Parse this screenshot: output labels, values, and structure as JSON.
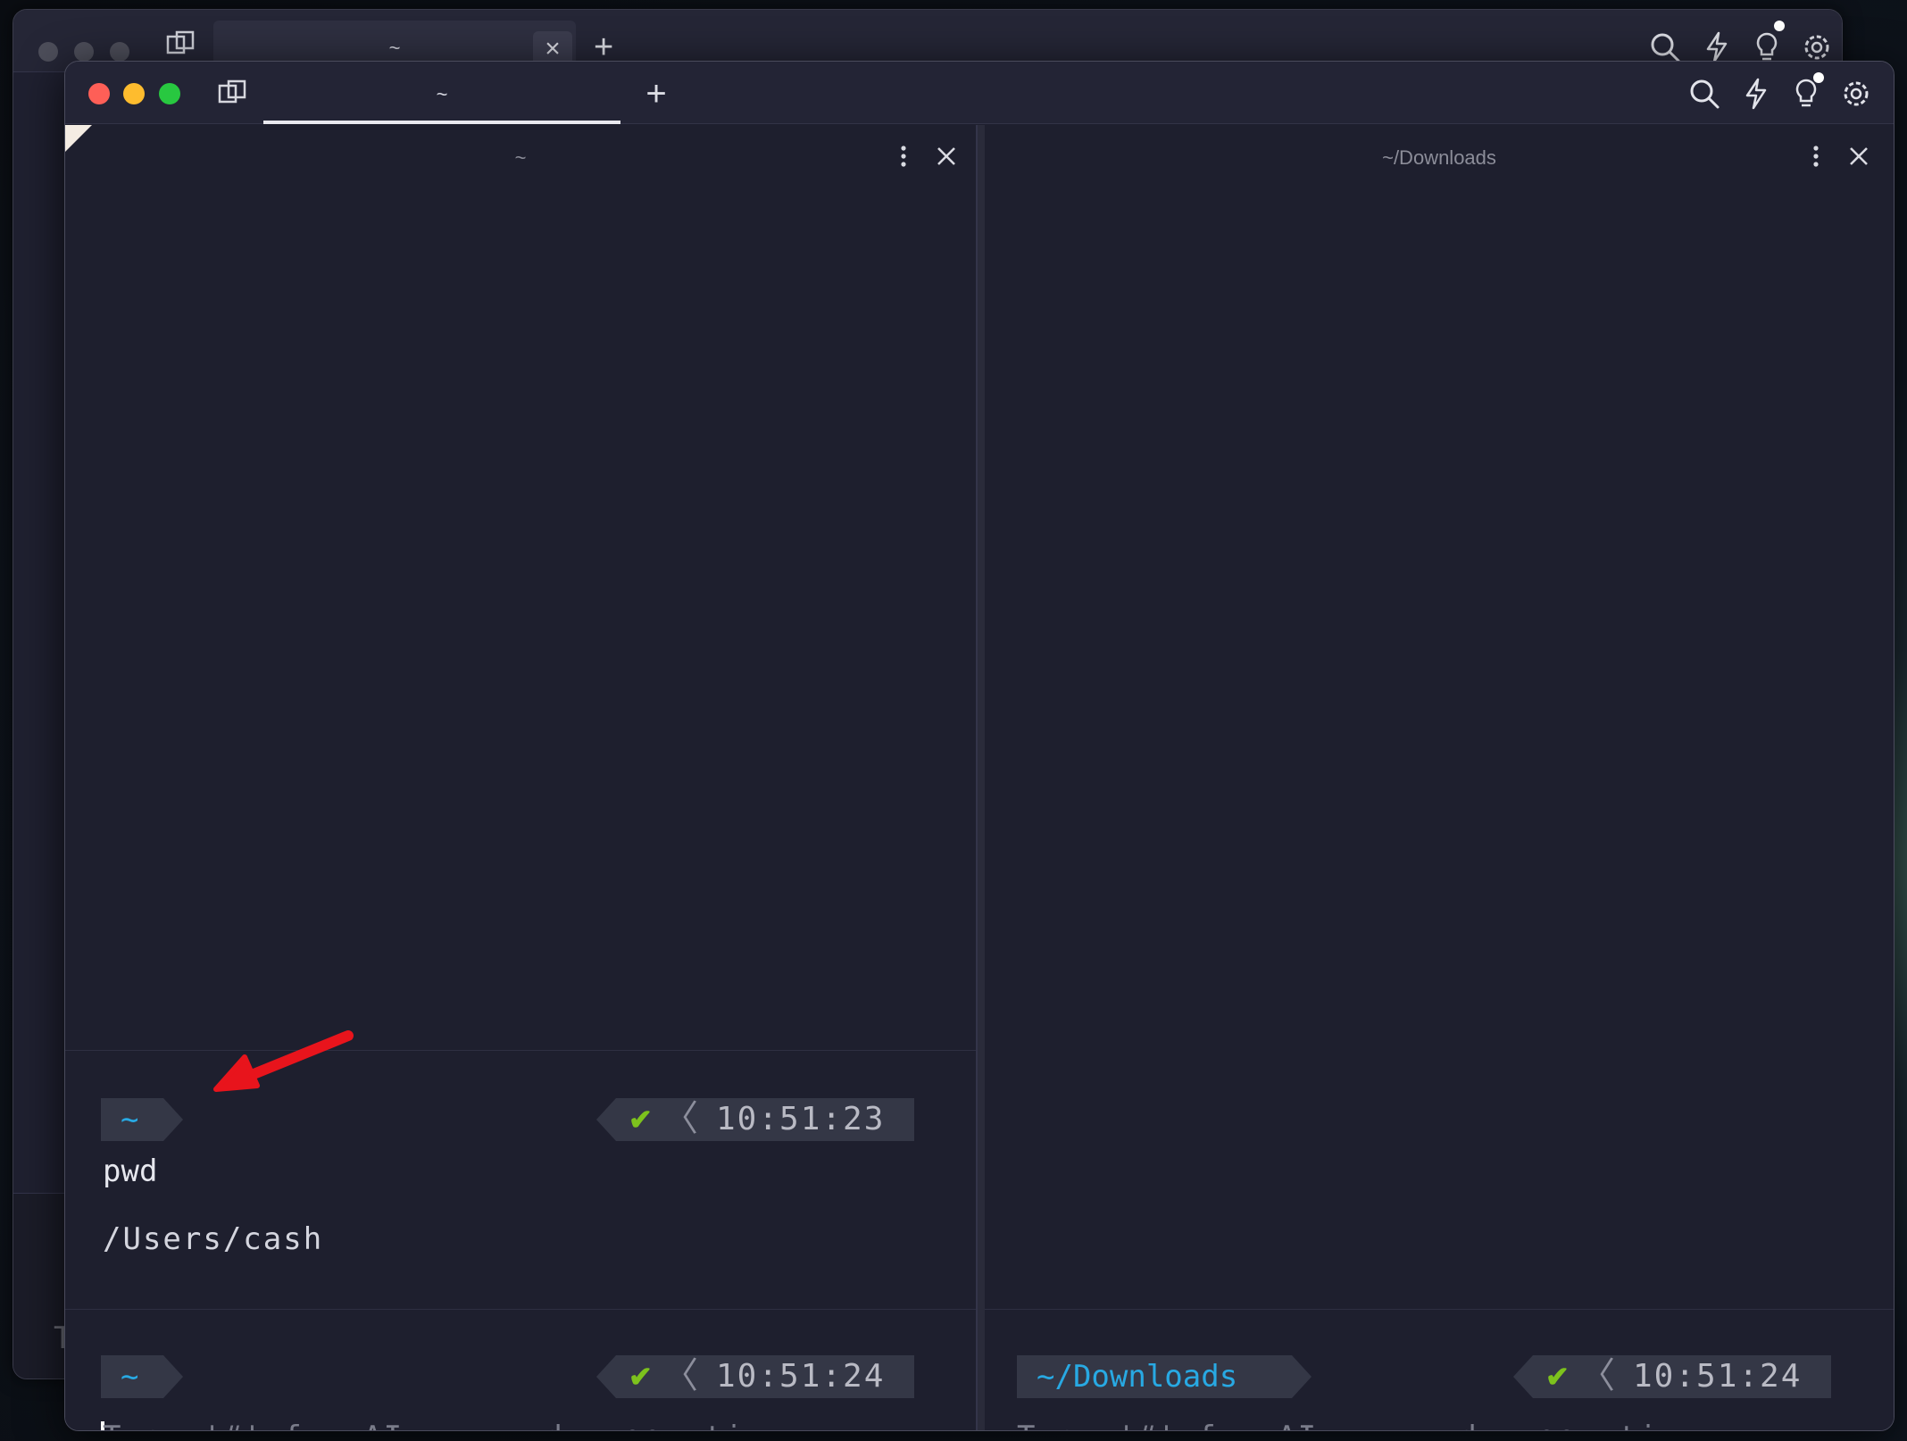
{
  "back_window": {
    "tab_title": "~",
    "tab_close_glyph": "×",
    "new_tab_glyph": "+",
    "peek_letter": "T"
  },
  "titlebar": {
    "active_tab_title": "~",
    "new_tab_glyph": "+",
    "icons": [
      "search-icon",
      "lightning-icon",
      "lightbulb-icon",
      "settings-icon"
    ]
  },
  "left_pane": {
    "title": "~",
    "block": {
      "prompt_dir": "~",
      "status_check": "✔",
      "status_chev": "〈",
      "time": "10:51:23",
      "command": "pwd",
      "output": "/Users/cash"
    },
    "input": {
      "prompt_dir": "~",
      "status_check": "✔",
      "status_chev": "〈",
      "time": "10:51:24",
      "placeholder": "Type '#' for AI command suggestions"
    }
  },
  "right_pane": {
    "title": "~/Downloads",
    "input": {
      "prompt_dir": "~/Downloads",
      "status_check": "✔",
      "status_chev": "〈",
      "time": "10:51:24",
      "placeholder": "Type '#' for AI command suggestions"
    }
  },
  "colors": {
    "accent_blue": "#28a9e3",
    "check_green": "#7dc21d",
    "annotation_red": "#e8141c"
  }
}
